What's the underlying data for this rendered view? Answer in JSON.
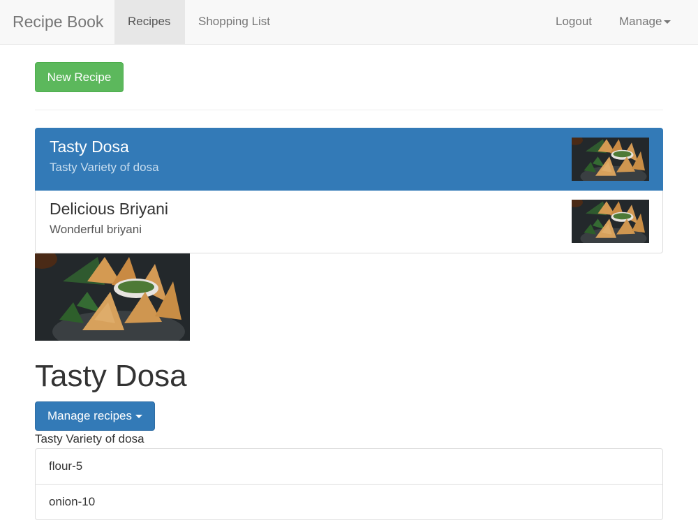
{
  "navbar": {
    "brand": "Recipe Book",
    "links": {
      "recipes": "Recipes",
      "shopping": "Shopping List"
    },
    "right": {
      "logout": "Logout",
      "manage": "Manage"
    }
  },
  "toolbar": {
    "new_recipe_label": "New Recipe"
  },
  "recipes": [
    {
      "name": "Tasty Dosa",
      "description": "Tasty Variety of dosa",
      "active": true,
      "image": "samosa-photo"
    },
    {
      "name": "Delicious Briyani",
      "description": "Wonderful briyani",
      "active": false,
      "image": "samosa-photo"
    }
  ],
  "detail": {
    "image": "samosa-photo",
    "title": "Tasty Dosa",
    "manage_label": "Manage recipes",
    "description": "Tasty Variety of dosa",
    "ingredients": [
      "flour-5",
      "onion-10"
    ]
  },
  "colors": {
    "primary": "#337ab7",
    "success": "#5cb85c",
    "navbar_bg": "#f8f8f8"
  }
}
